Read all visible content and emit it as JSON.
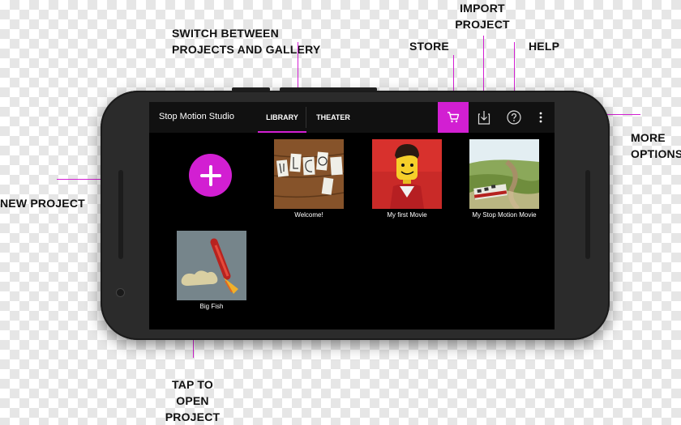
{
  "callouts": {
    "switch": "SWITCH BETWEEN PROJECTS AND GALLERY",
    "import": "IMPORT PROJECT",
    "store": "STORE",
    "help": "HELP",
    "more": "MORE OPTIONS",
    "new_project": "NEW PROJECT",
    "tap_to_open": "TAP TO OPEN PROJECT"
  },
  "app": {
    "title": "Stop Motion Studio",
    "tabs": [
      {
        "label": "LIBRARY",
        "active": true
      },
      {
        "label": "THEATER",
        "active": false
      }
    ],
    "icons": [
      "cart-icon",
      "import-icon",
      "help-icon",
      "more-vert-icon"
    ]
  },
  "library": {
    "projects": [
      {
        "caption": "Welcome!"
      },
      {
        "caption": "My first Movie"
      },
      {
        "caption": "My Stop Motion Movie"
      },
      {
        "caption": "Big Fish"
      }
    ]
  },
  "colors": {
    "accent": "#d21fd2",
    "screen_bg": "#000000",
    "appbar_bg": "#111111",
    "phone_body": "#2b2b2b"
  }
}
